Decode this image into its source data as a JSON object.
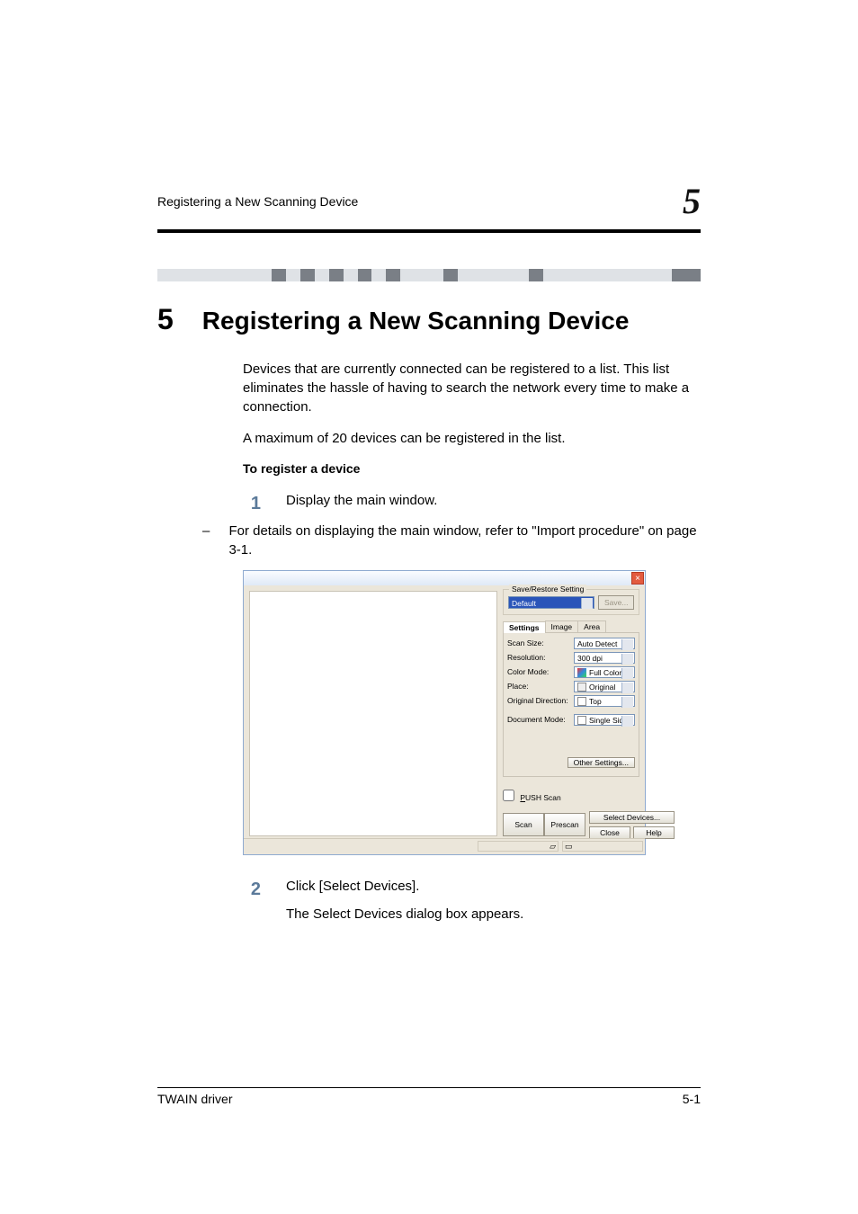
{
  "header": {
    "running_title": "Registering a New Scanning Device",
    "chapter_number_large": "5"
  },
  "chapter": {
    "number": "5",
    "title": "Registering a New Scanning Device"
  },
  "paragraphs": {
    "p1": "Devices that are currently connected can be registered to a list. This list eliminates the hassle of having to search the network every time to make a connection.",
    "p2": "A maximum of 20 devices can be registered in the list."
  },
  "subhead": "To register a device",
  "steps": {
    "s1_num": "1",
    "s1_text": "Display the main window.",
    "s1_sub_dash": "–",
    "s1_sub_text": "For details on displaying the main window, refer to \"Import procedure\" on page 3-1.",
    "s2_num": "2",
    "s2_text": "Click [Select Devices].",
    "s2_after": "The Select Devices dialog box appears."
  },
  "screenshot": {
    "save_restore_legend": "Save/Restore Setting",
    "save_preset": "Default",
    "save_btn": "Save...",
    "tabs": {
      "settings": "Settings",
      "image": "Image",
      "area": "Area"
    },
    "rows": {
      "scan_size_lbl": "Scan Size:",
      "scan_size_val": "Auto Detect",
      "resolution_lbl": "Resolution:",
      "resolution_val": "300 dpi",
      "color_lbl": "Color Mode:",
      "color_val": "Full Color",
      "place_lbl": "Place:",
      "place_val": "Original Glass",
      "orient_lbl": "Original Direction:",
      "orient_val": "Top",
      "docmode_lbl": "Document Mode:",
      "docmode_val": "Single Side"
    },
    "other_settings_btn": "Other Settings...",
    "push_scan_label": "PUSH Scan",
    "scan_btn": "Scan",
    "prescan_btn": "Prescan",
    "select_devices_btn": "Select Devices...",
    "close_btn": "Close",
    "help_btn": "Help"
  },
  "footer": {
    "left": "TWAIN driver",
    "right": "5-1"
  }
}
